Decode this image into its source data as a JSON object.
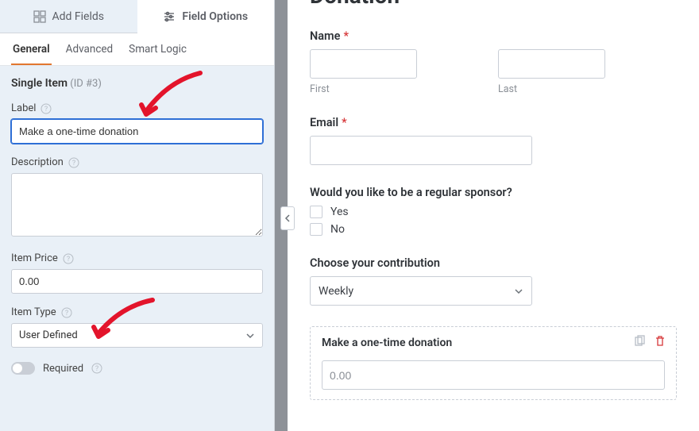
{
  "topTabs": {
    "addFields": "Add Fields",
    "fieldOptions": "Field Options"
  },
  "subTabs": {
    "general": "General",
    "advanced": "Advanced",
    "smart": "Smart Logic"
  },
  "panel": {
    "fieldName": "Single Item",
    "fieldIdLabel": " (ID #3)",
    "labelLabel": "Label",
    "labelValue": "Make a one-time donation",
    "descriptionLabel": "Description",
    "descriptionValue": "",
    "itemPriceLabel": "Item Price",
    "itemPriceValue": "0.00",
    "itemTypeLabel": "Item Type",
    "itemTypeValue": "User Defined",
    "requiredLabel": "Required"
  },
  "preview": {
    "headingPartial": "Donation",
    "name": {
      "label": "Name",
      "firstSub": "First",
      "lastSub": "Last"
    },
    "email": {
      "label": "Email"
    },
    "sponsor": {
      "label": "Would you like to be a regular sponsor?",
      "options": [
        "Yes",
        "No"
      ]
    },
    "contribution": {
      "label": "Choose your contribution",
      "selected": "Weekly"
    },
    "selectedField": {
      "label": "Make a one-time donation",
      "value": "0.00"
    }
  }
}
